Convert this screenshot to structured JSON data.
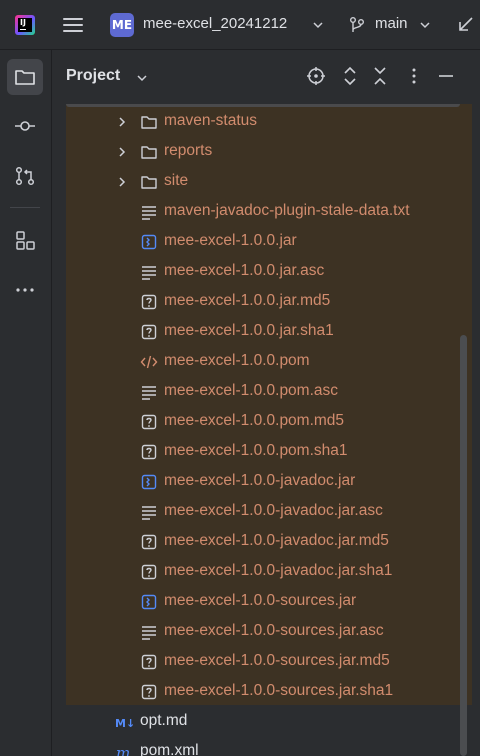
{
  "titlebar": {
    "project_badge": "ME",
    "project_name": "mee-excel_20241212",
    "branch_name": "main"
  },
  "panel": {
    "title": "Project"
  },
  "colors": {
    "ignored_text": "#d28c6e",
    "ignored_bg": "#3d3223",
    "folder": "#ced0d6",
    "jar_icon": "#548af7",
    "xml_icon": "#d28c6e",
    "md_icon": "#548af7"
  },
  "tree": {
    "folders": [
      {
        "label": "maven-status"
      },
      {
        "label": "reports"
      },
      {
        "label": "site"
      }
    ],
    "files": [
      {
        "label": "maven-javadoc-plugin-stale-data.txt",
        "icon": "text-icon"
      },
      {
        "label": "mee-excel-1.0.0.jar",
        "icon": "jar-icon"
      },
      {
        "label": "mee-excel-1.0.0.jar.asc",
        "icon": "text-icon"
      },
      {
        "label": "mee-excel-1.0.0.jar.md5",
        "icon": "unknown-file-icon"
      },
      {
        "label": "mee-excel-1.0.0.jar.sha1",
        "icon": "unknown-file-icon"
      },
      {
        "label": "mee-excel-1.0.0.pom",
        "icon": "xml-icon"
      },
      {
        "label": "mee-excel-1.0.0.pom.asc",
        "icon": "text-icon"
      },
      {
        "label": "mee-excel-1.0.0.pom.md5",
        "icon": "unknown-file-icon"
      },
      {
        "label": "mee-excel-1.0.0.pom.sha1",
        "icon": "unknown-file-icon"
      },
      {
        "label": "mee-excel-1.0.0-javadoc.jar",
        "icon": "jar-icon"
      },
      {
        "label": "mee-excel-1.0.0-javadoc.jar.asc",
        "icon": "text-icon"
      },
      {
        "label": "mee-excel-1.0.0-javadoc.jar.md5",
        "icon": "unknown-file-icon"
      },
      {
        "label": "mee-excel-1.0.0-javadoc.jar.sha1",
        "icon": "unknown-file-icon"
      },
      {
        "label": "mee-excel-1.0.0-sources.jar",
        "icon": "jar-icon"
      },
      {
        "label": "mee-excel-1.0.0-sources.jar.asc",
        "icon": "text-icon"
      },
      {
        "label": "mee-excel-1.0.0-sources.jar.md5",
        "icon": "unknown-file-icon"
      },
      {
        "label": "mee-excel-1.0.0-sources.jar.sha1",
        "icon": "unknown-file-icon"
      }
    ],
    "root_files": [
      {
        "label": "opt.md",
        "icon": "markdown-icon"
      },
      {
        "label": "pom.xml",
        "icon": "maven-icon"
      }
    ]
  }
}
